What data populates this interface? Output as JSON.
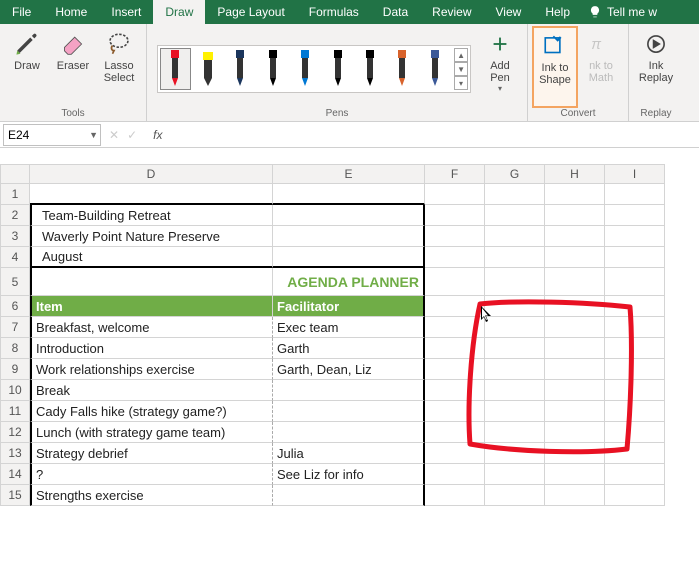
{
  "menu": [
    "File",
    "Home",
    "Insert",
    "Draw",
    "Page Layout",
    "Formulas",
    "Data",
    "Review",
    "View",
    "Help"
  ],
  "menu_active": "Draw",
  "tell_me": "Tell me w",
  "ribbon": {
    "tools": {
      "label": "Tools",
      "draw": "Draw",
      "eraser": "Eraser",
      "lasso": "Lasso\nSelect"
    },
    "pens": {
      "label": "Pens",
      "add": "Add\nPen"
    },
    "convert": {
      "label": "Convert",
      "shape": "Ink to\nShape",
      "math": "nk to\nMath"
    },
    "replay": {
      "label": "Replay",
      "replay": "Ink\nReplay"
    }
  },
  "namebox": "E24",
  "cols": [
    "D",
    "E",
    "F",
    "G",
    "H",
    "I"
  ],
  "rows": [
    {
      "n": 1,
      "d": "",
      "e": ""
    },
    {
      "n": 2,
      "d": "Team-Building Retreat",
      "e": ""
    },
    {
      "n": 3,
      "d": "Waverly Point Nature Preserve",
      "e": ""
    },
    {
      "n": 4,
      "d": "August",
      "e": ""
    },
    {
      "n": 5,
      "d": "",
      "e": "AGENDA PLANNER"
    },
    {
      "n": 6,
      "d": "Item",
      "e": "Facilitator"
    },
    {
      "n": 7,
      "d": "Breakfast, welcome",
      "e": "Exec team"
    },
    {
      "n": 8,
      "d": "Introduction",
      "e": "Garth"
    },
    {
      "n": 9,
      "d": "Work relationships exercise",
      "e": "Garth, Dean, Liz"
    },
    {
      "n": 10,
      "d": "Break",
      "e": ""
    },
    {
      "n": 11,
      "d": "Cady Falls hike (strategy game?)",
      "e": ""
    },
    {
      "n": 12,
      "d": "Lunch (with strategy game team)",
      "e": ""
    },
    {
      "n": 13,
      "d": "Strategy debrief",
      "e": "Julia"
    },
    {
      "n": 14,
      "d": "?",
      "e": "See Liz for info"
    },
    {
      "n": 15,
      "d": "Strengths exercise",
      "e": ""
    }
  ]
}
